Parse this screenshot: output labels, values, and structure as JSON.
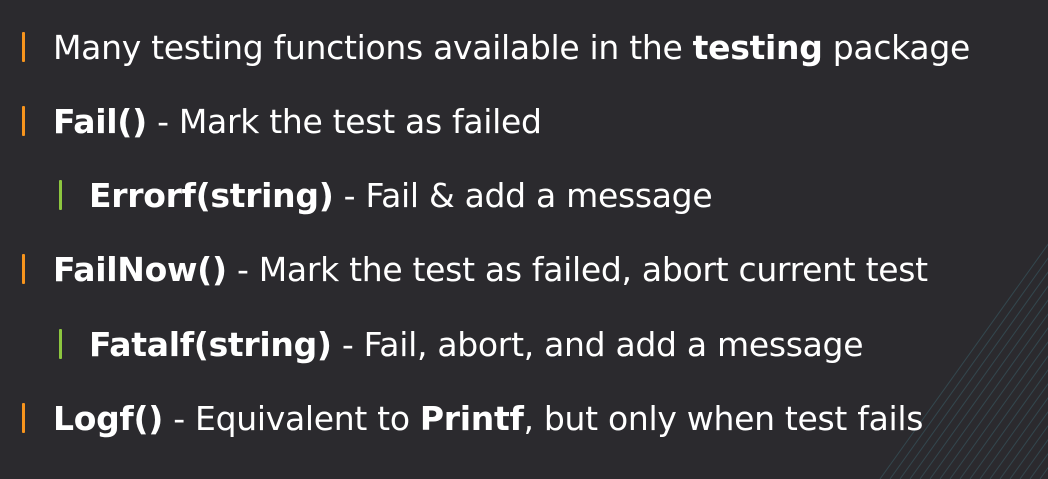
{
  "colors": {
    "background": "#2b2a2e",
    "text": "#ffffff",
    "bullet_level_1": "#f7941d",
    "bullet_level_2": "#8dc63f",
    "hatch_lines": "#3a5f69"
  },
  "bullets": [
    {
      "level": 1,
      "lead_bold": "",
      "middle": "Many testing functions available in the ",
      "bold_inline": "testing",
      "tail": " package"
    },
    {
      "level": 1,
      "lead_bold": "Fail()",
      "middle": " - Mark the test as failed",
      "bold_inline": "",
      "tail": ""
    },
    {
      "level": 2,
      "lead_bold": "Errorf(string)",
      "middle": " - Fail & add a message",
      "bold_inline": "",
      "tail": ""
    },
    {
      "level": 1,
      "lead_bold": "FailNow()",
      "middle": " - Mark the test as failed, abort current test",
      "bold_inline": "",
      "tail": ""
    },
    {
      "level": 2,
      "lead_bold": "Fatalf(string)",
      "middle": " - Fail, abort, and add a message",
      "bold_inline": "",
      "tail": ""
    },
    {
      "level": 1,
      "lead_bold": "Logf()",
      "middle": " - Equivalent to ",
      "bold_inline": "Printf",
      "tail": ", but only when test fails"
    }
  ]
}
